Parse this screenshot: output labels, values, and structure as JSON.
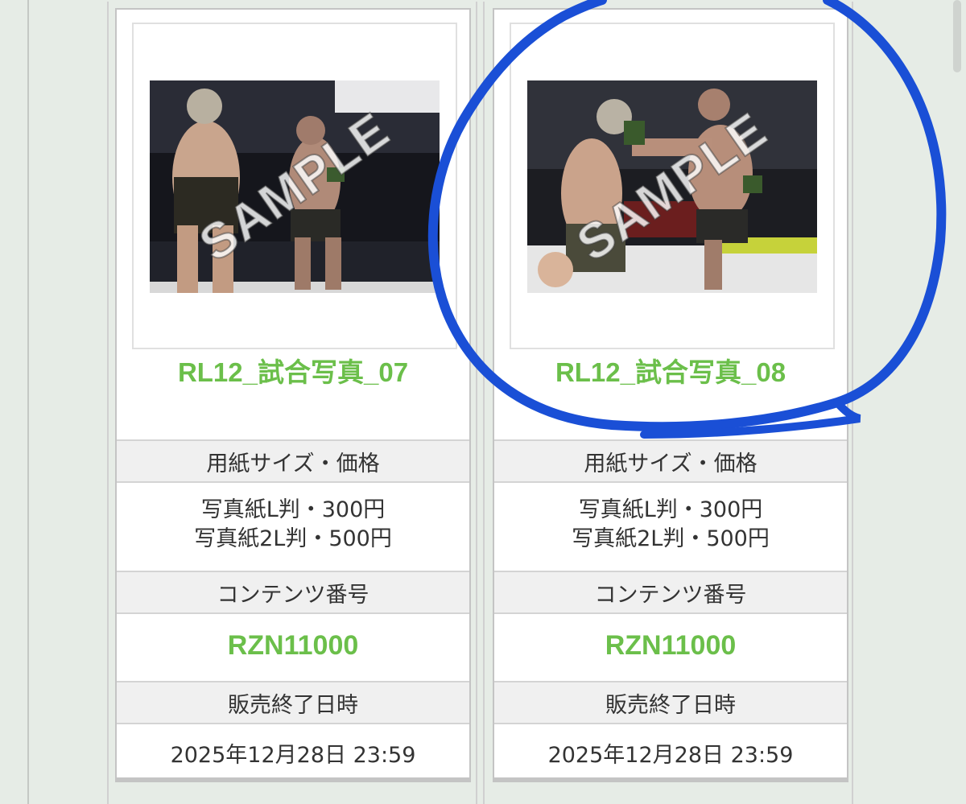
{
  "products": [
    {
      "title": "RL12_試合写真_07",
      "watermark": "SAMPLE",
      "price_header": "用紙サイズ・価格",
      "prices": [
        "写真紙L判・300円",
        "写真紙2L判・500円"
      ],
      "code_header": "コンテンツ番号",
      "code": "RZN11000",
      "end_header": "販売終了日時",
      "end_datetime": "2025年12月28日 23:59"
    },
    {
      "title": "RL12_試合写真_08",
      "watermark": "SAMPLE",
      "price_header": "用紙サイズ・価格",
      "prices": [
        "写真紙L判・300円",
        "写真紙2L判・500円"
      ],
      "code_header": "コンテンツ番号",
      "code": "RZN11000",
      "end_header": "販売終了日時",
      "end_datetime": "2025年12月28日 23:59"
    }
  ],
  "colors": {
    "accent_green": "#6bbf4a",
    "annotation_blue": "#1a4fd6",
    "background": "#e6ece6"
  }
}
